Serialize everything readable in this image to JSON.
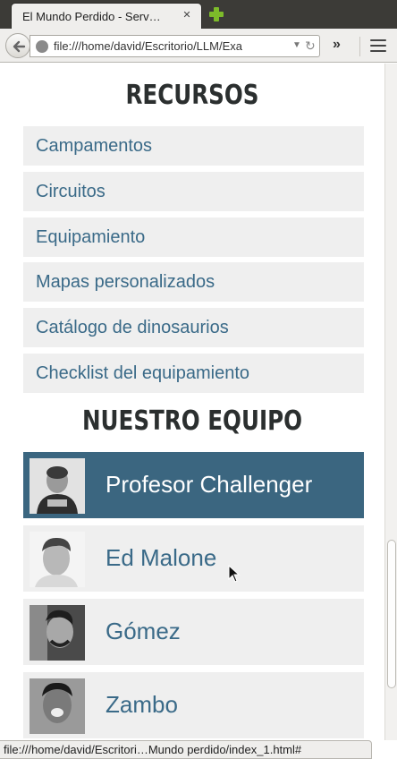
{
  "browser": {
    "tab_title": "El Mundo Perdido - Serv…",
    "tab_close_icon": "close-icon",
    "new_tab_icon": "plus-icon",
    "url": "file:///home/david/Escritorio/LLM/Exa",
    "overflow": "»",
    "status_url": "file:///home/david/Escritori…Mundo perdido/index_1.html#"
  },
  "resources": {
    "title": "RECURSOS",
    "items": [
      {
        "label": "Campamentos"
      },
      {
        "label": "Circuitos"
      },
      {
        "label": "Equipamiento"
      },
      {
        "label": "Mapas personalizados"
      },
      {
        "label": "Catálogo de dinosaurios"
      },
      {
        "label": "Checklist del equipamiento"
      }
    ]
  },
  "team": {
    "title": "NUESTRO EQUIPO",
    "members": [
      {
        "name": "Profesor Challenger",
        "active": true
      },
      {
        "name": "Ed Malone",
        "active": false
      },
      {
        "name": "Gómez",
        "active": false
      },
      {
        "name": "Zambo",
        "active": false
      }
    ]
  },
  "colors": {
    "link": "#3a6a88",
    "active_bg": "#3b6680",
    "item_bg": "#efefef",
    "heading": "#2b2f2f"
  }
}
